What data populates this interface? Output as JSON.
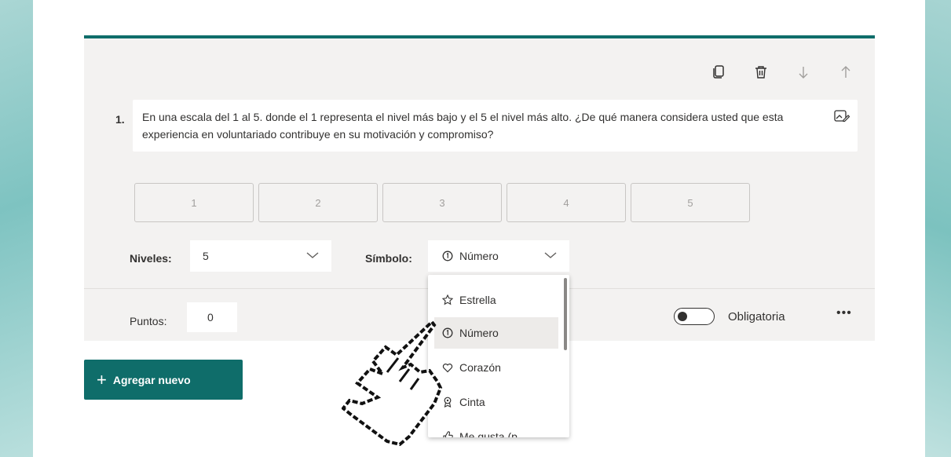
{
  "question": {
    "number": "1.",
    "text": "En una escala del 1 al 5. donde el 1 representa el nivel más bajo y el 5 el nivel más alto. ¿De qué manera considera usted que esta experiencia en voluntariado contribuye en su motivación y compromiso?"
  },
  "rating_options": [
    "1",
    "2",
    "3",
    "4",
    "5"
  ],
  "settings": {
    "levels_label": "Niveles:",
    "levels_value": "5",
    "symbol_label": "Símbolo:",
    "symbol_value": "Número"
  },
  "symbol_dropdown": {
    "items": [
      {
        "label": "Estrella",
        "icon": "star-icon"
      },
      {
        "label": "Número",
        "icon": "number-icon",
        "selected": true
      },
      {
        "label": "Corazón",
        "icon": "heart-icon"
      },
      {
        "label": "Cinta",
        "icon": "ribbon-icon"
      },
      {
        "label": "Me gusta (p",
        "icon": "thumbs-up-icon"
      }
    ]
  },
  "footer": {
    "points_label": "Puntos:",
    "points_value": "0",
    "required_label": "Obligatoria",
    "required_on": false,
    "more_label": "•••"
  },
  "add_button": {
    "plus": "+",
    "label": "Agregar nuevo"
  },
  "colors": {
    "accent": "#0f6d6a",
    "card_bg": "#f3f2f1"
  }
}
